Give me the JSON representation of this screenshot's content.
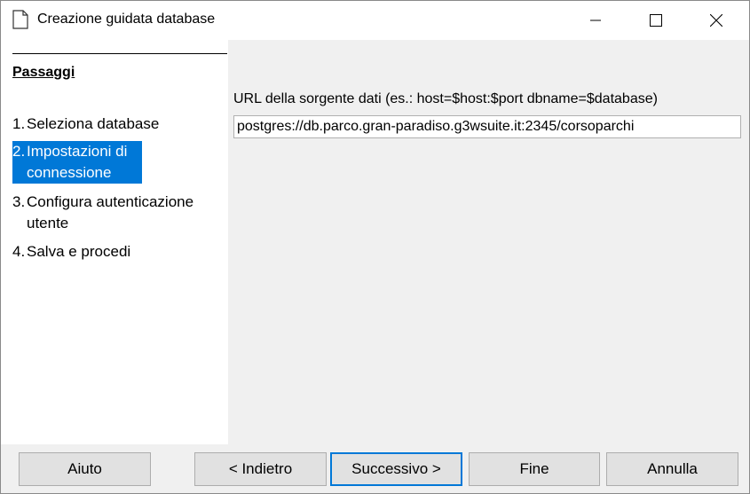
{
  "window": {
    "title": "Creazione guidata database"
  },
  "steps": {
    "title": "Passaggi",
    "items": [
      {
        "num": "1.",
        "label": "Seleziona database"
      },
      {
        "num": "2.",
        "label": "Impostazioni di connessione",
        "selected": true
      },
      {
        "num": "3.",
        "label": "Configura autenticazione utente"
      },
      {
        "num": "4.",
        "label": "Salva e procedi"
      }
    ]
  },
  "connection": {
    "url_label": "URL della sorgente dati (es.: host=$host:$port dbname=$database)",
    "url_value": "postgres://db.parco.gran-paradiso.g3wsuite.it:2345/corsoparchi"
  },
  "buttons": {
    "help": "Aiuto",
    "back": "< Indietro",
    "next": "Successivo >",
    "finish": "Fine",
    "cancel": "Annulla"
  },
  "colors": {
    "selection": "#0078d7",
    "panel": "#f0f0f0"
  }
}
